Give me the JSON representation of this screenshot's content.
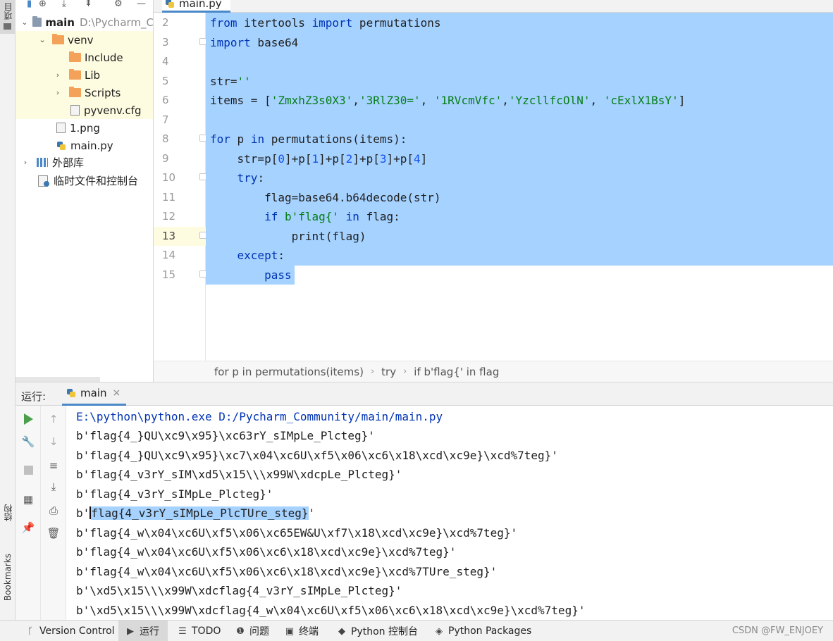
{
  "sidebar": {
    "project_tab": "项目",
    "structure_tab": "结构",
    "bookmarks_tab": "Bookmarks"
  },
  "project_tree": {
    "items": [
      {
        "label": "main",
        "path": "D:\\Pycharm_C",
        "kind": "folder-root"
      },
      {
        "label": "venv",
        "kind": "folder"
      },
      {
        "label": "Include",
        "kind": "folder"
      },
      {
        "label": "Lib",
        "kind": "folder"
      },
      {
        "label": "Scripts",
        "kind": "folder"
      },
      {
        "label": "pyvenv.cfg",
        "kind": "file"
      },
      {
        "label": "1.png",
        "kind": "file"
      },
      {
        "label": "main.py",
        "kind": "python-file"
      },
      {
        "label": "外部库",
        "kind": "library"
      },
      {
        "label": "临时文件和控制台",
        "kind": "scratch"
      }
    ]
  },
  "editor": {
    "tab_label": "main.py",
    "line_numbers": [
      "2",
      "3",
      "4",
      "5",
      "6",
      "7",
      "8",
      "9",
      "10",
      "11",
      "12",
      "13",
      "14",
      "15"
    ],
    "current_line": "13"
  },
  "breadcrumb": {
    "items": [
      "for p in permutations(items)",
      "try",
      "if b'flag{' in flag"
    ]
  },
  "run": {
    "label": "运行:",
    "tab": "main",
    "command": "E:\\python\\python.exe D:/Pycharm_Community/main/main.py",
    "output": [
      "b'flag{4_}QU\\xc9\\x95}\\xc63rY_sIMpLe_Plcteg}'",
      "b'flag{4_}QU\\xc9\\x95}\\xc7\\x04\\xc6U\\xf5\\x06\\xc6\\x18\\xcd\\xc9e}\\xcd%7teg}'",
      "b'flag{4_v3rY_sIM\\xd5\\x15\\\\\\x99W\\xdcpLe_Plcteg}'",
      "b'flag{4_v3rY_sIMpLe_Plcteg}'",
      "b'flag{4_v3rY_sIMpLe_PlcTUre_steg}'",
      "b'flag{4_w\\x04\\xc6U\\xf5\\x06\\xc65EW&U\\xf7\\x18\\xcd\\xc9e}\\xcd%7teg}'",
      "b'flag{4_w\\x04\\xc6U\\xf5\\x06\\xc6\\x18\\xcd\\xc9e}\\xcd%7teg}'",
      "b'flag{4_w\\x04\\xc6U\\xf5\\x06\\xc6\\x18\\xcd\\xc9e}\\xcd%7TUre_steg}'",
      "b'\\xd5\\x15\\\\\\x99W\\xdcflag{4_v3rY_sIMpLe_Plcteg}'",
      "b'\\xd5\\x15\\\\\\x99W\\xdcflag{4_w\\x04\\xc6U\\xf5\\x06\\xc6\\x18\\xcd\\xc9e}\\xcd%7teg}'"
    ],
    "highlight": {
      "prefix": "b'",
      "selected": "flag{4_v3rY_sIMpLe_PlcTUre_steg}",
      "suffix": "'"
    }
  },
  "status_bar": {
    "items": [
      "Version Control",
      "运行",
      "TODO",
      "问题",
      "终端",
      "Python 控制台",
      "Python Packages"
    ],
    "watermark": "CSDN @FW_ENJOEY"
  },
  "colors": {
    "selection": "#a6d2ff",
    "keyword": "#0033b3",
    "string": "#067d17",
    "number": "#1750eb",
    "accent": "#4a88c7"
  }
}
